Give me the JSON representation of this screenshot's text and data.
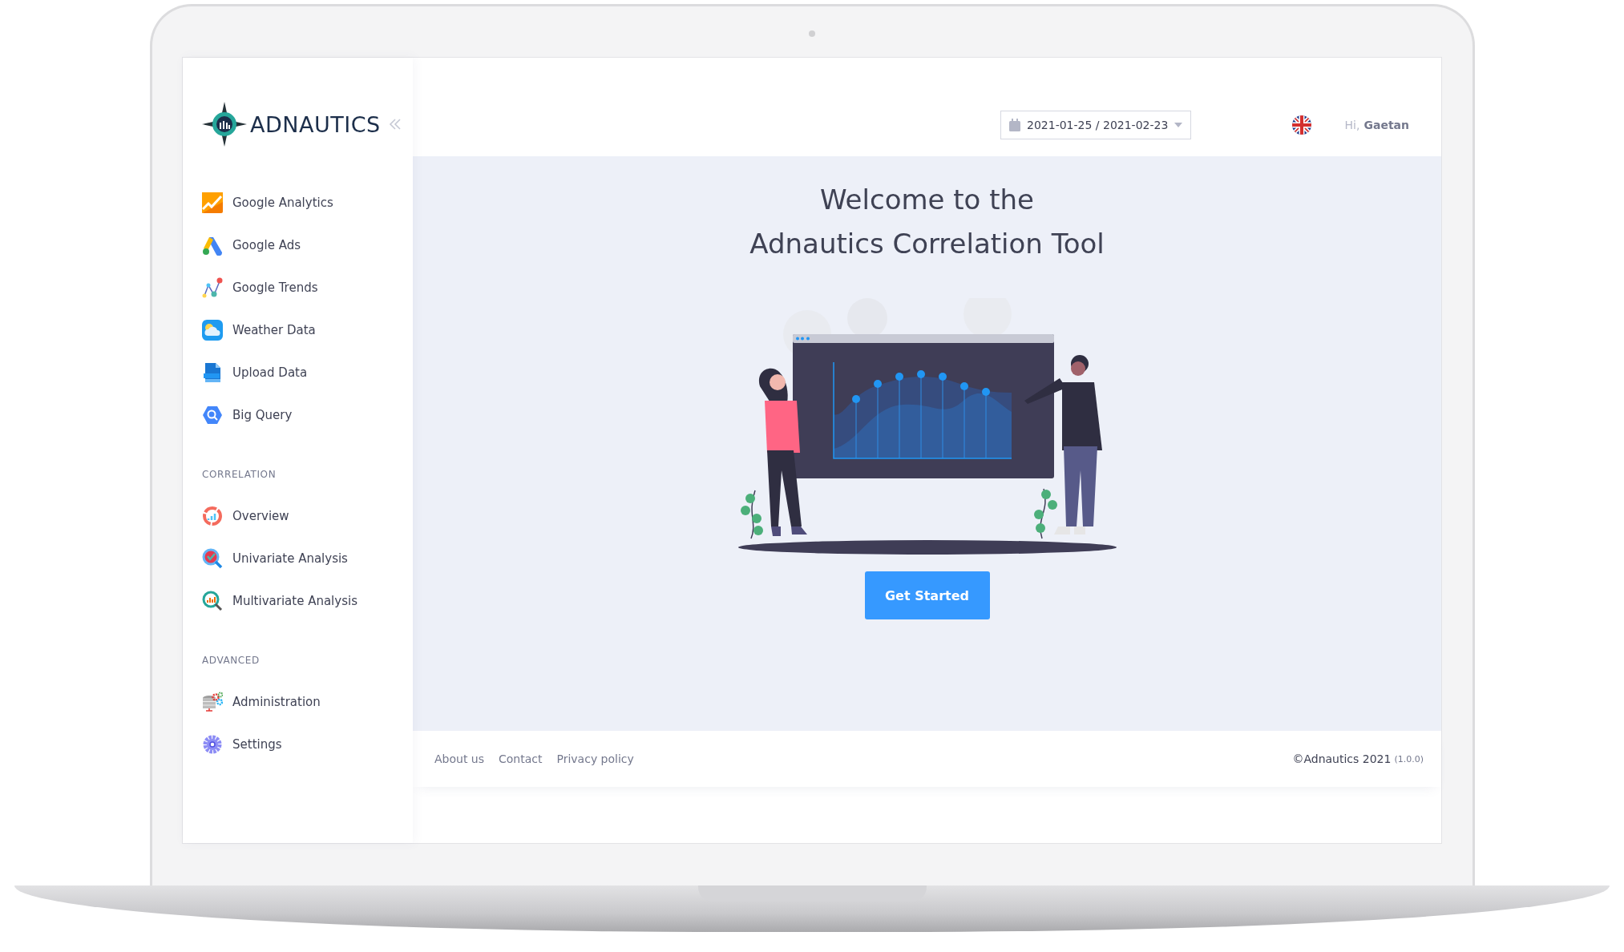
{
  "brand": {
    "name": "ADNAUTICS"
  },
  "sidebar": {
    "groups": [
      {
        "items": [
          {
            "label": "Google Analytics"
          },
          {
            "label": "Google Ads"
          },
          {
            "label": "Google Trends"
          },
          {
            "label": "Weather Data"
          },
          {
            "label": "Upload Data"
          },
          {
            "label": "Big Query"
          }
        ]
      },
      {
        "heading": "CORRELATION",
        "items": [
          {
            "label": "Overview"
          },
          {
            "label": "Univariate Analysis"
          },
          {
            "label": "Multivariate Analysis"
          }
        ]
      },
      {
        "heading": "ADVANCED",
        "items": [
          {
            "label": "Administration"
          },
          {
            "label": "Settings"
          }
        ]
      }
    ]
  },
  "header": {
    "date_range": "2021-01-25 / 2021-02-23",
    "greeting": "Hi,",
    "user_name": "Gaetan"
  },
  "welcome": {
    "title_lines": [
      "Welcome to the",
      "Adnautics Correlation Tool"
    ],
    "button": "Get Started"
  },
  "footer": {
    "links": [
      "About us",
      "Contact",
      "Privacy policy"
    ],
    "copyright": "©Adnautics 2021",
    "version": "(1.0.0)"
  }
}
